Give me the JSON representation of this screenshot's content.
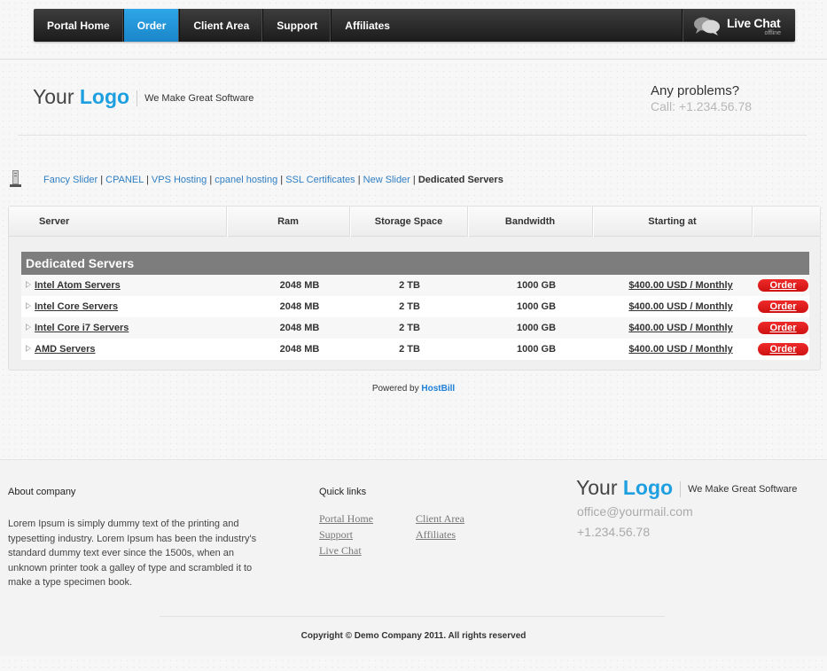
{
  "nav": {
    "items": [
      {
        "label": "Portal Home"
      },
      {
        "label": "Order"
      },
      {
        "label": "Client Area"
      },
      {
        "label": "Support"
      },
      {
        "label": "Affiliates"
      }
    ],
    "active": "Order",
    "livechat": {
      "label": "Live Chat",
      "status": "offline"
    }
  },
  "header": {
    "logo_prefix": "Your",
    "logo_brand": "Logo",
    "tagline": "We Make Great Software",
    "problems_title": "Any problems?",
    "problems_call": "Call: +1.234.56.78"
  },
  "breadcrumb": {
    "links": [
      "Fancy Slider",
      "CPANEL",
      "VPS Hosting",
      "cpanel hosting",
      "SSL Certificates",
      "New Slider"
    ],
    "separator": " | ",
    "current": "Dedicated Servers"
  },
  "table": {
    "headers": [
      "Server",
      "Ram",
      "Storage Space",
      "Bandwidth",
      "Starting at"
    ],
    "category": "Dedicated Servers",
    "rows": [
      {
        "name": "Intel Atom Servers",
        "ram": "2048 MB",
        "storage": "2 TB",
        "bandwidth": "1000 GB",
        "price": "$400.00 USD / Monthly",
        "order": "Order"
      },
      {
        "name": "Intel Core Servers",
        "ram": "2048 MB",
        "storage": "2 TB",
        "bandwidth": "1000 GB",
        "price": "$400.00 USD / Monthly",
        "order": "Order"
      },
      {
        "name": "Intel Core i7 Servers",
        "ram": "2048 MB",
        "storage": "2 TB",
        "bandwidth": "1000 GB",
        "price": "$400.00 USD / Monthly",
        "order": "Order"
      },
      {
        "name": "AMD Servers",
        "ram": "2048 MB",
        "storage": "2 TB",
        "bandwidth": "1000 GB",
        "price": "$400.00 USD / Monthly",
        "order": "Order"
      }
    ]
  },
  "powered": {
    "prefix": "Powered by",
    "brand": "HostBill"
  },
  "footer": {
    "about_title": "About company",
    "about_text": "Lorem Ipsum is simply dummy text of the printing and typesetting industry. Lorem Ipsum has been the industry's standard dummy text ever since the 1500s, when an unknown printer took a galley of type and scrambled it to make a type specimen book.",
    "links_title": "Quick links",
    "links_col1": [
      "Portal Home",
      "Support",
      "Live Chat"
    ],
    "links_col2": [
      "Client Area",
      "Affiliates"
    ],
    "logo_prefix": "Your",
    "logo_brand": "Logo",
    "tagline": "We Make Great Software",
    "email": "office@yourmail.com",
    "phone": "+1.234.56.78",
    "copyright": "Copyright © Demo Company 2011. All rights reserved"
  },
  "colors": {
    "accent": "#1e9fe0",
    "nav_bg": "#2b2b2b",
    "order_button": "#e01c1c",
    "category_bar": "#7d7d7d"
  },
  "icons": {
    "livechat": "chat-bubbles-icon",
    "breadcrumb": "server-tower-icon",
    "row": "triangle-arrow-icon"
  }
}
